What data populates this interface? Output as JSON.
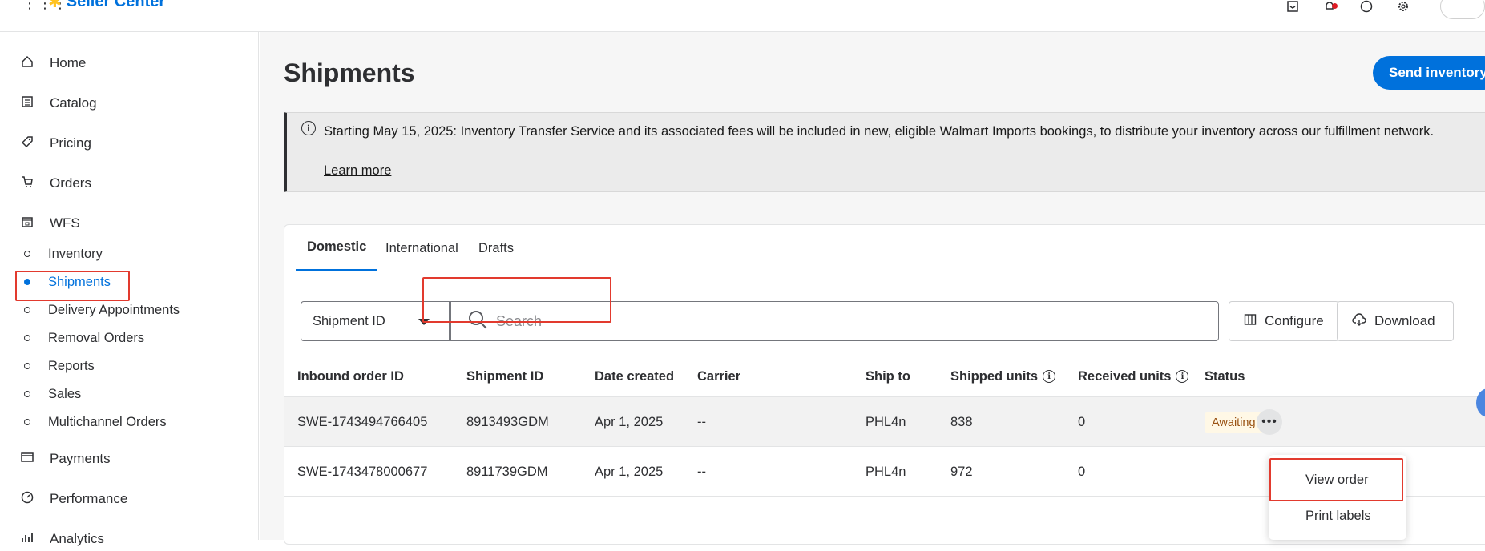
{
  "topbar": {
    "grid_glyph": "⋮⋮⋮",
    "logo_glyph": "✱",
    "brand": "Seller Center",
    "icons": [
      "inbox-icon",
      "bell-icon",
      "help-icon",
      "gear-icon",
      "flag-avatar"
    ]
  },
  "sidebar": {
    "items": [
      {
        "label": "Home",
        "icon": "home-icon"
      },
      {
        "label": "Catalog",
        "icon": "catalog-icon"
      },
      {
        "label": "Pricing",
        "icon": "tag-icon"
      },
      {
        "label": "Orders",
        "icon": "cart-icon"
      },
      {
        "label": "WFS",
        "icon": "warehouse-icon"
      }
    ],
    "wfs_sub": [
      {
        "label": "Inventory"
      },
      {
        "label": "Shipments",
        "active": true
      },
      {
        "label": "Delivery Appointments"
      },
      {
        "label": "Removal Orders"
      },
      {
        "label": "Reports"
      },
      {
        "label": "Sales"
      },
      {
        "label": "Multichannel Orders"
      }
    ],
    "bottom_items": [
      {
        "label": "Payments",
        "icon": "card-icon"
      },
      {
        "label": "Performance",
        "icon": "gauge-icon"
      },
      {
        "label": "Analytics",
        "icon": "chart-icon"
      }
    ]
  },
  "main": {
    "title": "Shipments",
    "send_button": "Send inventory",
    "alert": {
      "text": "Starting May 15, 2025: Inventory Transfer Service and its associated fees will be included in new, eligible Walmart Imports bookings, to distribute your inventory across our fulfillment network.",
      "link": "Learn more"
    },
    "tabs": [
      "Domestic",
      "International",
      "Drafts"
    ],
    "filter": {
      "select_value": "Shipment ID",
      "search_placeholder": "Search",
      "configure": "Configure",
      "download": "Download"
    },
    "table": {
      "columns": [
        "Inbound order ID",
        "Shipment ID",
        "Date created",
        "Carrier",
        "Ship to",
        "Shipped units",
        "Received units",
        "Status"
      ],
      "rows": [
        {
          "inbound": "SWE-1743494766405",
          "shipment": "8913493GDM",
          "date": "Apr 1, 2025",
          "carrier": "--",
          "ship_to": "PHL4n",
          "shipped": "838",
          "received": "0",
          "status": "Awaiting"
        },
        {
          "inbound": "SWE-1743478000677",
          "shipment": "8911739GDM",
          "date": "Apr 1, 2025",
          "carrier": "--",
          "ship_to": "PHL4n",
          "shipped": "972",
          "received": "0",
          "status": ""
        }
      ]
    },
    "row_menu": [
      "View order",
      "Print labels"
    ]
  },
  "colors": {
    "accent": "#0071dc",
    "highlight_box": "#e23a2e",
    "status_awaiting_bg": "#fff8e6"
  }
}
